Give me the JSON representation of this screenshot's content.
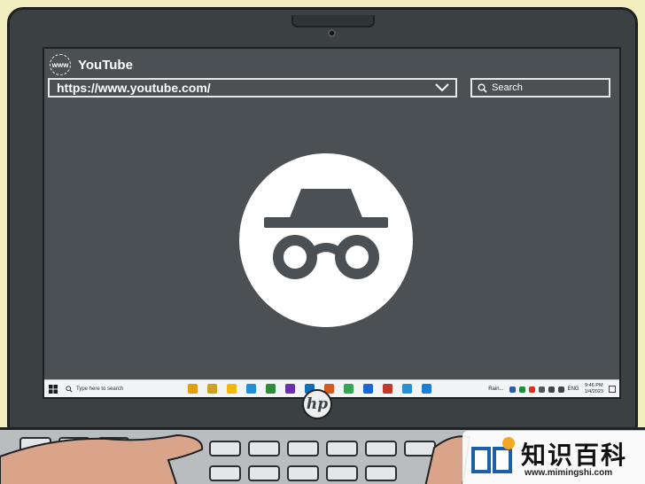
{
  "browser": {
    "tab_title": "YouTube",
    "globe_text": "www",
    "url": "https://www.youtube.com/",
    "search_placeholder": "Search"
  },
  "taskbar": {
    "search_placeholder": "Type here to search",
    "weather_text": "Rain...",
    "language": "ENG",
    "time": "9:46 PM",
    "date": "1/4/2023",
    "app_colors": [
      "#e0a010",
      "#d0a020",
      "#f2b705",
      "#1f8fd8",
      "#2e8b3a",
      "#6b2fb1",
      "#0e6fb8",
      "#d65a1e",
      "#33a852",
      "#1967d2",
      "#c0392b",
      "#2a8fd1",
      "#1c7fd3"
    ]
  },
  "brand": {
    "logo_text": "hp"
  },
  "watermark": {
    "cn": "知识百科",
    "url": "www.mimingshi.com"
  },
  "colors": {
    "bezel": "#3b4042",
    "screen": "#4a5054",
    "background": "#f3eebd",
    "incognito_icon": "#4a5054"
  },
  "icons": {
    "center": "incognito-icon",
    "tab": "globe-icon",
    "url_dropdown": "chevron-down-icon",
    "search": "search-icon",
    "start": "windows-icon"
  }
}
